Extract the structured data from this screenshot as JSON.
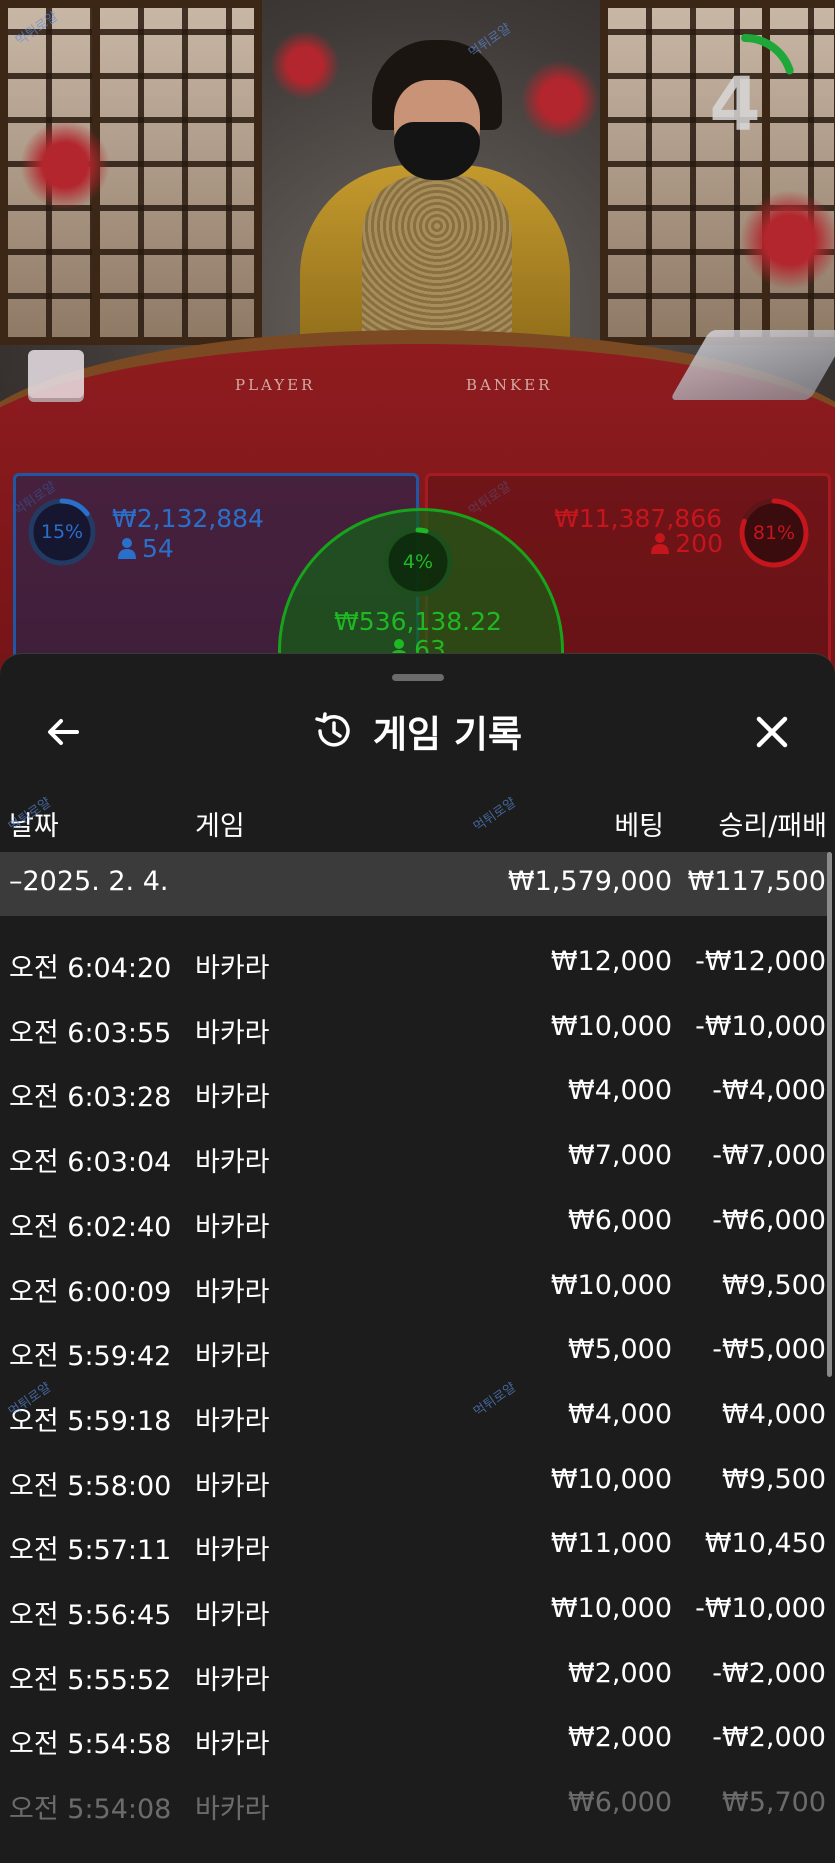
{
  "timer": {
    "value": "4",
    "progress": 0.2
  },
  "table": {
    "player_label": "PLAYER",
    "banker_label": "BANKER"
  },
  "bets": {
    "player": {
      "percent": "15%",
      "amount": "₩2,132,884",
      "count": "54",
      "color": "#2a6fc9"
    },
    "tie": {
      "percent": "4%",
      "amount": "₩536,138.22",
      "count": "63",
      "color": "#1fb824"
    },
    "banker": {
      "percent": "81%",
      "amount": "₩11,387,866",
      "count": "200",
      "color": "#c4161c"
    }
  },
  "watermark": "먹튀로얄",
  "history": {
    "title": "게임 기록",
    "columns": {
      "date": "날짜",
      "game": "게임",
      "bet": "베팅",
      "result": "승리/패배"
    },
    "summary": {
      "date": "–2025. 2. 4.",
      "bet": "₩1,579,000",
      "result": "₩117,500"
    },
    "rows": [
      {
        "time": "오전 6:04:20",
        "game": "바카라",
        "bet": "₩12,000",
        "result": "-₩12,000"
      },
      {
        "time": "오전 6:03:55",
        "game": "바카라",
        "bet": "₩10,000",
        "result": "-₩10,000"
      },
      {
        "time": "오전 6:03:28",
        "game": "바카라",
        "bet": "₩4,000",
        "result": "-₩4,000"
      },
      {
        "time": "오전 6:03:04",
        "game": "바카라",
        "bet": "₩7,000",
        "result": "-₩7,000"
      },
      {
        "time": "오전 6:02:40",
        "game": "바카라",
        "bet": "₩6,000",
        "result": "-₩6,000"
      },
      {
        "time": "오전 6:00:09",
        "game": "바카라",
        "bet": "₩10,000",
        "result": "₩9,500"
      },
      {
        "time": "오전 5:59:42",
        "game": "바카라",
        "bet": "₩5,000",
        "result": "-₩5,000"
      },
      {
        "time": "오전 5:59:18",
        "game": "바카라",
        "bet": "₩4,000",
        "result": "₩4,000"
      },
      {
        "time": "오전 5:58:00",
        "game": "바카라",
        "bet": "₩10,000",
        "result": "₩9,500"
      },
      {
        "time": "오전 5:57:11",
        "game": "바카라",
        "bet": "₩11,000",
        "result": "₩10,450"
      },
      {
        "time": "오전 5:56:45",
        "game": "바카라",
        "bet": "₩10,000",
        "result": "-₩10,000"
      },
      {
        "time": "오전 5:55:52",
        "game": "바카라",
        "bet": "₩2,000",
        "result": "-₩2,000"
      },
      {
        "time": "오전 5:54:58",
        "game": "바카라",
        "bet": "₩2,000",
        "result": "-₩2,000"
      },
      {
        "time": "오전 5:54:08",
        "game": "바카라",
        "bet": "₩6,000",
        "result": "₩5,700"
      }
    ]
  }
}
